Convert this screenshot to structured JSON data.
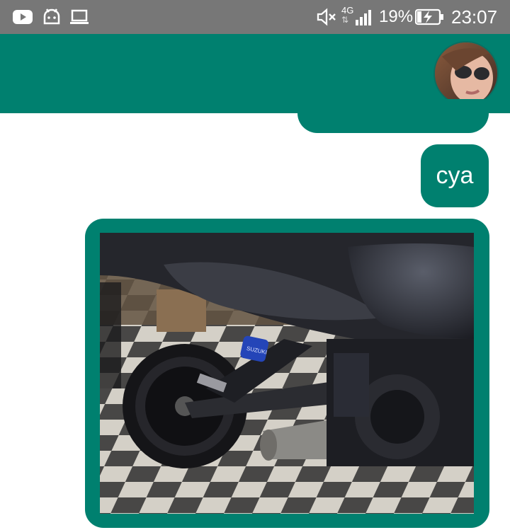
{
  "status_bar": {
    "time": "23:07",
    "battery_percent": "19%",
    "network": "4G",
    "icons": [
      "youtube-icon",
      "android-icon",
      "laptop-icon",
      "mute-icon",
      "signal-icon",
      "battery-charging-icon"
    ]
  },
  "app_bar": {
    "avatar": "contact-avatar"
  },
  "messages": [
    {
      "type": "text",
      "text": "cya",
      "direction": "sent"
    },
    {
      "type": "image",
      "description": "motorcycle-photo",
      "direction": "sent"
    }
  ],
  "colors": {
    "status_bar": "#777777",
    "accent": "#00806f",
    "background": "#ffffff"
  }
}
